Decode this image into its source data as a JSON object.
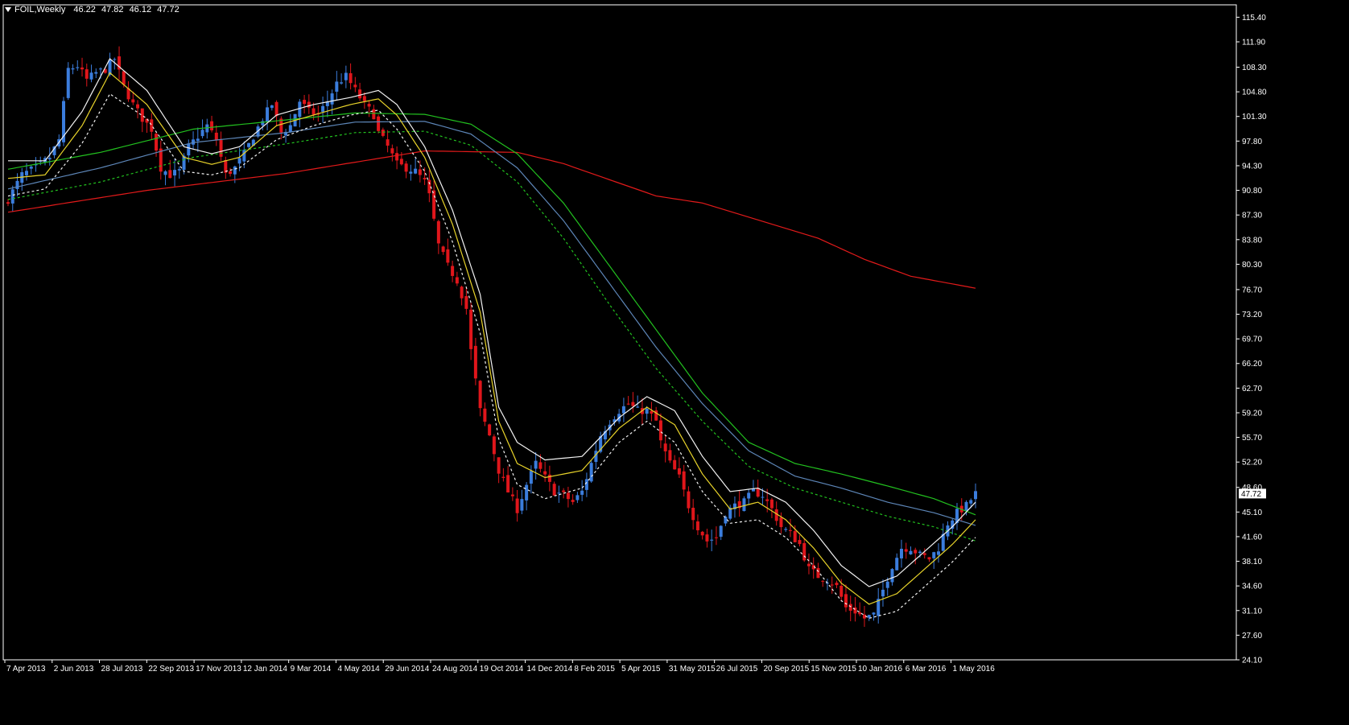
{
  "window": {
    "symbol": "FOIL,Weekly",
    "ohlc": [
      "46.22",
      "47.82",
      "46.12",
      "47.72"
    ]
  },
  "colors": {
    "background": "#000000",
    "frame": "#ffffff",
    "bull": "#3b7ddd",
    "bear": "#e0161b",
    "ema_white": "#f2f2f2",
    "ema_yellow": "#e8d32a",
    "ema_green": "#22c11f",
    "ema_steel": "#5d86b8",
    "ema_green_dash": "#22c11f",
    "ema_red": "#e21a1a",
    "price_tag_bg": "#ffffff"
  },
  "chart_data": {
    "type": "candlestick",
    "ylim": [
      24.1,
      117.16
    ],
    "y_ticks": [
      "115.40",
      "111.90",
      "108.30",
      "104.80",
      "101.30",
      "97.80",
      "94.30",
      "90.80",
      "87.30",
      "83.80",
      "80.30",
      "76.70",
      "73.20",
      "69.70",
      "66.20",
      "62.70",
      "59.20",
      "55.70",
      "52.20",
      "48.60",
      "45.10",
      "41.60",
      "38.10",
      "34.60",
      "31.10",
      "27.60",
      "24.10"
    ],
    "x_ticks": [
      "7 Apr 2013",
      "2 Jun 2013",
      "28 Jul 2013",
      "22 Sep 2013",
      "17 Nov 2013",
      "12 Jan 2014",
      "9 Mar 2014",
      "4 May 2014",
      "29 Jun 2014",
      "24 Aug 2014",
      "19 Oct 2014",
      "14 Dec 2014",
      "8 Feb 2015",
      "5 Apr 2015",
      "31 May 2015",
      "26 Jul 2015",
      "20 Sep 2015",
      "15 Nov 2015",
      "10 Jan 2016",
      "6 Mar 2016",
      "1 May 2016"
    ],
    "last_price": "47.72",
    "close_path": [
      [
        0,
        89.5
      ],
      [
        3,
        93.0
      ],
      [
        6,
        94.0
      ],
      [
        9,
        95.5
      ],
      [
        11,
        98.0
      ],
      [
        13,
        108.0
      ],
      [
        15,
        108.5
      ],
      [
        17,
        106.5
      ],
      [
        19,
        107.5
      ],
      [
        21,
        108.0
      ],
      [
        23,
        109.5
      ],
      [
        25,
        105.5
      ],
      [
        27,
        103.0
      ],
      [
        29,
        101.0
      ],
      [
        31,
        99.5
      ],
      [
        33,
        94.0
      ],
      [
        35,
        93.0
      ],
      [
        37,
        93.5
      ],
      [
        39,
        97.0
      ],
      [
        41,
        98.5
      ],
      [
        43,
        100.0
      ],
      [
        45,
        98.0
      ],
      [
        47,
        93.0
      ],
      [
        49,
        94.0
      ],
      [
        51,
        96.0
      ],
      [
        53,
        98.5
      ],
      [
        55,
        101.0
      ],
      [
        57,
        103.0
      ],
      [
        59,
        99.0
      ],
      [
        61,
        100.0
      ],
      [
        63,
        103.5
      ],
      [
        65,
        102.0
      ],
      [
        67,
        101.5
      ],
      [
        69,
        103.5
      ],
      [
        71,
        106.0
      ],
      [
        73,
        107.0
      ],
      [
        75,
        105.0
      ],
      [
        77,
        103.0
      ],
      [
        79,
        101.5
      ],
      [
        80,
        99.0
      ],
      [
        82,
        97.0
      ],
      [
        84,
        94.5
      ],
      [
        86,
        94.0
      ],
      [
        88,
        93.5
      ],
      [
        90,
        92.0
      ],
      [
        91,
        90.0
      ],
      [
        93,
        83.0
      ],
      [
        95,
        80.0
      ],
      [
        97,
        78.0
      ],
      [
        99,
        74.0
      ],
      [
        100,
        68.0
      ],
      [
        102,
        59.5
      ],
      [
        104,
        56.0
      ],
      [
        106,
        51.0
      ],
      [
        108,
        48.0
      ],
      [
        110,
        45.5
      ],
      [
        112,
        49.0
      ],
      [
        114,
        52.0
      ],
      [
        116,
        50.0
      ],
      [
        118,
        48.0
      ],
      [
        120,
        47.5
      ],
      [
        122,
        46.5
      ],
      [
        124,
        48.0
      ],
      [
        126,
        52.0
      ],
      [
        128,
        56.0
      ],
      [
        130,
        58.0
      ],
      [
        132,
        59.5
      ],
      [
        134,
        60.5
      ],
      [
        136,
        59.5
      ],
      [
        138,
        59.5
      ],
      [
        140,
        58.0
      ],
      [
        141,
        55.0
      ],
      [
        143,
        52.0
      ],
      [
        145,
        50.0
      ],
      [
        147,
        46.0
      ],
      [
        149,
        43.0
      ],
      [
        151,
        41.0
      ],
      [
        153,
        41.5
      ],
      [
        155,
        45.0
      ],
      [
        157,
        46.0
      ],
      [
        159,
        46.5
      ],
      [
        161,
        48.0
      ],
      [
        163,
        47.5
      ],
      [
        165,
        45.5
      ],
      [
        167,
        43.0
      ],
      [
        169,
        42.0
      ],
      [
        171,
        40.5
      ],
      [
        173,
        37.0
      ],
      [
        175,
        36.0
      ],
      [
        177,
        35.5
      ],
      [
        179,
        34.5
      ],
      [
        181,
        31.5
      ],
      [
        183,
        31.0
      ],
      [
        185,
        30.0
      ],
      [
        187,
        30.5
      ],
      [
        189,
        34.0
      ],
      [
        191,
        37.5
      ],
      [
        193,
        40.0
      ],
      [
        195,
        40.0
      ],
      [
        197,
        39.0
      ],
      [
        199,
        38.5
      ],
      [
        201,
        40.0
      ],
      [
        203,
        43.5
      ],
      [
        205,
        45.0
      ],
      [
        207,
        46.0
      ],
      [
        209,
        47.72
      ]
    ],
    "ema_red_path": [
      [
        0,
        87.7
      ],
      [
        30,
        90.8
      ],
      [
        60,
        93.2
      ],
      [
        90,
        96.4
      ],
      [
        110,
        96.2
      ],
      [
        120,
        94.6
      ],
      [
        130,
        92.3
      ],
      [
        140,
        90.0
      ],
      [
        150,
        89.0
      ],
      [
        160,
        87.0
      ],
      [
        175,
        84.0
      ],
      [
        185,
        81.0
      ],
      [
        195,
        78.6
      ],
      [
        209,
        76.9
      ]
    ],
    "ema_green_path": [
      [
        0,
        93.8
      ],
      [
        20,
        96.2
      ],
      [
        40,
        99.5
      ],
      [
        60,
        100.8
      ],
      [
        75,
        101.8
      ],
      [
        90,
        101.6
      ],
      [
        100,
        100.2
      ],
      [
        110,
        96.0
      ],
      [
        120,
        89.0
      ],
      [
        130,
        80.0
      ],
      [
        140,
        71.0
      ],
      [
        150,
        62.0
      ],
      [
        160,
        55.0
      ],
      [
        170,
        52.0
      ],
      [
        180,
        50.5
      ],
      [
        190,
        48.8
      ],
      [
        200,
        47.0
      ],
      [
        209,
        44.7
      ]
    ],
    "ema_steel_path": [
      [
        0,
        91.0
      ],
      [
        20,
        94.0
      ],
      [
        40,
        97.6
      ],
      [
        60,
        99.0
      ],
      [
        75,
        100.5
      ],
      [
        90,
        100.6
      ],
      [
        100,
        98.8
      ],
      [
        110,
        94.0
      ],
      [
        120,
        86.5
      ],
      [
        130,
        77.5
      ],
      [
        140,
        68.5
      ],
      [
        150,
        60.5
      ],
      [
        160,
        53.8
      ],
      [
        170,
        50.2
      ],
      [
        180,
        48.5
      ],
      [
        190,
        46.5
      ],
      [
        200,
        45.0
      ],
      [
        209,
        43.2
      ]
    ],
    "ema_green_dash_path": [
      [
        0,
        89.5
      ],
      [
        20,
        92.0
      ],
      [
        40,
        95.5
      ],
      [
        60,
        97.4
      ],
      [
        75,
        99.0
      ],
      [
        90,
        99.2
      ],
      [
        100,
        97.2
      ],
      [
        110,
        92.0
      ],
      [
        120,
        84.0
      ],
      [
        130,
        74.5
      ],
      [
        140,
        65.5
      ],
      [
        150,
        58.0
      ],
      [
        160,
        51.6
      ],
      [
        170,
        48.5
      ],
      [
        180,
        46.5
      ],
      [
        190,
        44.5
      ],
      [
        200,
        43.0
      ],
      [
        209,
        41.0
      ]
    ],
    "band_upper_path": [
      [
        0,
        95.0
      ],
      [
        8,
        95.0
      ],
      [
        16,
        102.0
      ],
      [
        22,
        109.5
      ],
      [
        30,
        105.0
      ],
      [
        38,
        97.0
      ],
      [
        44,
        96.0
      ],
      [
        50,
        97.0
      ],
      [
        58,
        101.5
      ],
      [
        66,
        103.0
      ],
      [
        74,
        104.0
      ],
      [
        80,
        105.0
      ],
      [
        84,
        103.0
      ],
      [
        90,
        97.0
      ],
      [
        96,
        88.0
      ],
      [
        102,
        76.0
      ],
      [
        106,
        60.0
      ],
      [
        110,
        55.0
      ],
      [
        116,
        52.5
      ],
      [
        124,
        53.0
      ],
      [
        132,
        58.5
      ],
      [
        138,
        61.5
      ],
      [
        144,
        59.5
      ],
      [
        150,
        53.0
      ],
      [
        156,
        48.0
      ],
      [
        162,
        48.5
      ],
      [
        168,
        46.5
      ],
      [
        174,
        42.5
      ],
      [
        180,
        37.5
      ],
      [
        186,
        34.5
      ],
      [
        192,
        36.0
      ],
      [
        198,
        39.5
      ],
      [
        204,
        43.0
      ],
      [
        209,
        46.5
      ]
    ],
    "band_middle_path": [
      [
        0,
        92.5
      ],
      [
        8,
        93.0
      ],
      [
        16,
        100.0
      ],
      [
        22,
        107.5
      ],
      [
        30,
        103.0
      ],
      [
        38,
        95.5
      ],
      [
        44,
        94.5
      ],
      [
        50,
        95.5
      ],
      [
        58,
        100.0
      ],
      [
        66,
        101.5
      ],
      [
        74,
        103.0
      ],
      [
        80,
        103.8
      ],
      [
        84,
        101.5
      ],
      [
        90,
        95.5
      ],
      [
        96,
        86.0
      ],
      [
        102,
        73.5
      ],
      [
        106,
        58.0
      ],
      [
        110,
        52.0
      ],
      [
        116,
        50.0
      ],
      [
        124,
        51.0
      ],
      [
        132,
        57.0
      ],
      [
        138,
        60.0
      ],
      [
        144,
        57.5
      ],
      [
        150,
        50.5
      ],
      [
        156,
        45.5
      ],
      [
        162,
        46.5
      ],
      [
        168,
        44.0
      ],
      [
        174,
        40.0
      ],
      [
        180,
        35.0
      ],
      [
        186,
        32.0
      ],
      [
        192,
        33.5
      ],
      [
        198,
        37.0
      ],
      [
        204,
        40.5
      ],
      [
        209,
        44.0
      ]
    ],
    "band_lower_path": [
      [
        0,
        90.0
      ],
      [
        8,
        91.0
      ],
      [
        16,
        97.5
      ],
      [
        22,
        104.5
      ],
      [
        30,
        101.0
      ],
      [
        38,
        93.5
      ],
      [
        44,
        93.0
      ],
      [
        50,
        94.0
      ],
      [
        58,
        98.0
      ],
      [
        66,
        100.0
      ],
      [
        74,
        101.5
      ],
      [
        80,
        102.2
      ],
      [
        84,
        99.5
      ],
      [
        90,
        93.5
      ],
      [
        96,
        83.5
      ],
      [
        102,
        70.5
      ],
      [
        106,
        55.5
      ],
      [
        110,
        49.0
      ],
      [
        116,
        47.0
      ],
      [
        124,
        48.5
      ],
      [
        132,
        55.0
      ],
      [
        138,
        58.0
      ],
      [
        144,
        55.0
      ],
      [
        150,
        48.0
      ],
      [
        156,
        43.5
      ],
      [
        162,
        44.0
      ],
      [
        168,
        41.5
      ],
      [
        174,
        37.5
      ],
      [
        180,
        32.5
      ],
      [
        186,
        30.0
      ],
      [
        192,
        31.0
      ],
      [
        198,
        34.5
      ],
      [
        204,
        38.0
      ],
      [
        209,
        41.5
      ]
    ]
  }
}
